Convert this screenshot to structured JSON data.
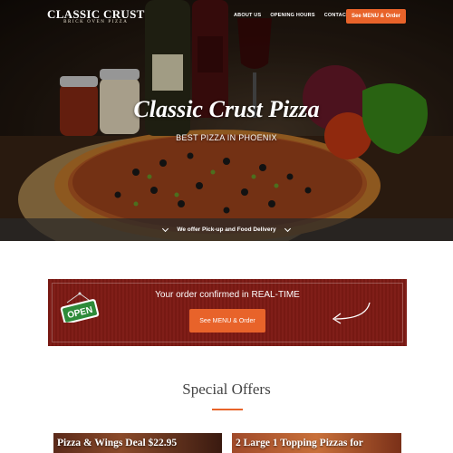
{
  "brand": {
    "name": "CLASSIC CRUST",
    "tagline": "BRICK OVEN PIZZA"
  },
  "nav": {
    "links": [
      "ABOUT US",
      "OPENING HOURS",
      "CONTACT US"
    ],
    "cta": "See MENU & Order"
  },
  "hero": {
    "title": "Classic Crust Pizza",
    "subtitle": "BEST PIZZA IN PHOENIX",
    "bar_text": "We offer Pick-up and Food Delivery"
  },
  "order_banner": {
    "text": "Your order confirmed in REAL-TIME",
    "button": "See MENU & Order",
    "sign_text": "OPEN"
  },
  "offers": {
    "title": "Special Offers",
    "cards": [
      {
        "title": "Pizza & Wings Deal $22.95"
      },
      {
        "title": "2 Large 1 Topping Pizzas for"
      }
    ]
  },
  "colors": {
    "accent": "#e8632a",
    "banner": "#7d1a14",
    "open_sign": "#2e8b3a"
  }
}
